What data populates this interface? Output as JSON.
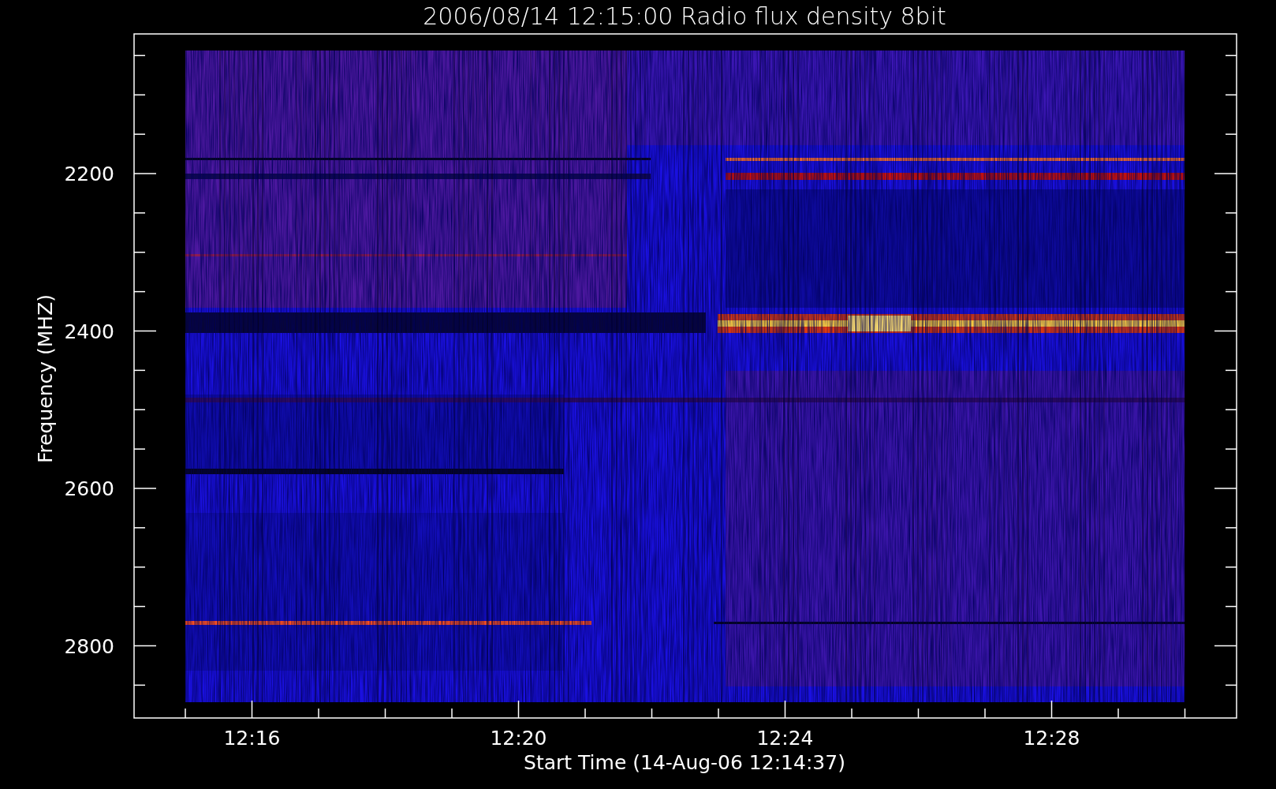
{
  "title": "2006/08/14 12:15:00 Radio flux density 8bit",
  "y_axis": {
    "label": "Frequency (MHZ)",
    "tick_labels": [
      "2200",
      "2400",
      "2600",
      "2800"
    ]
  },
  "x_axis": {
    "label": "Start Time (14-Aug-06 12:14:37)",
    "tick_labels": [
      "12:16",
      "12:20",
      "12:24",
      "12:28"
    ]
  }
}
